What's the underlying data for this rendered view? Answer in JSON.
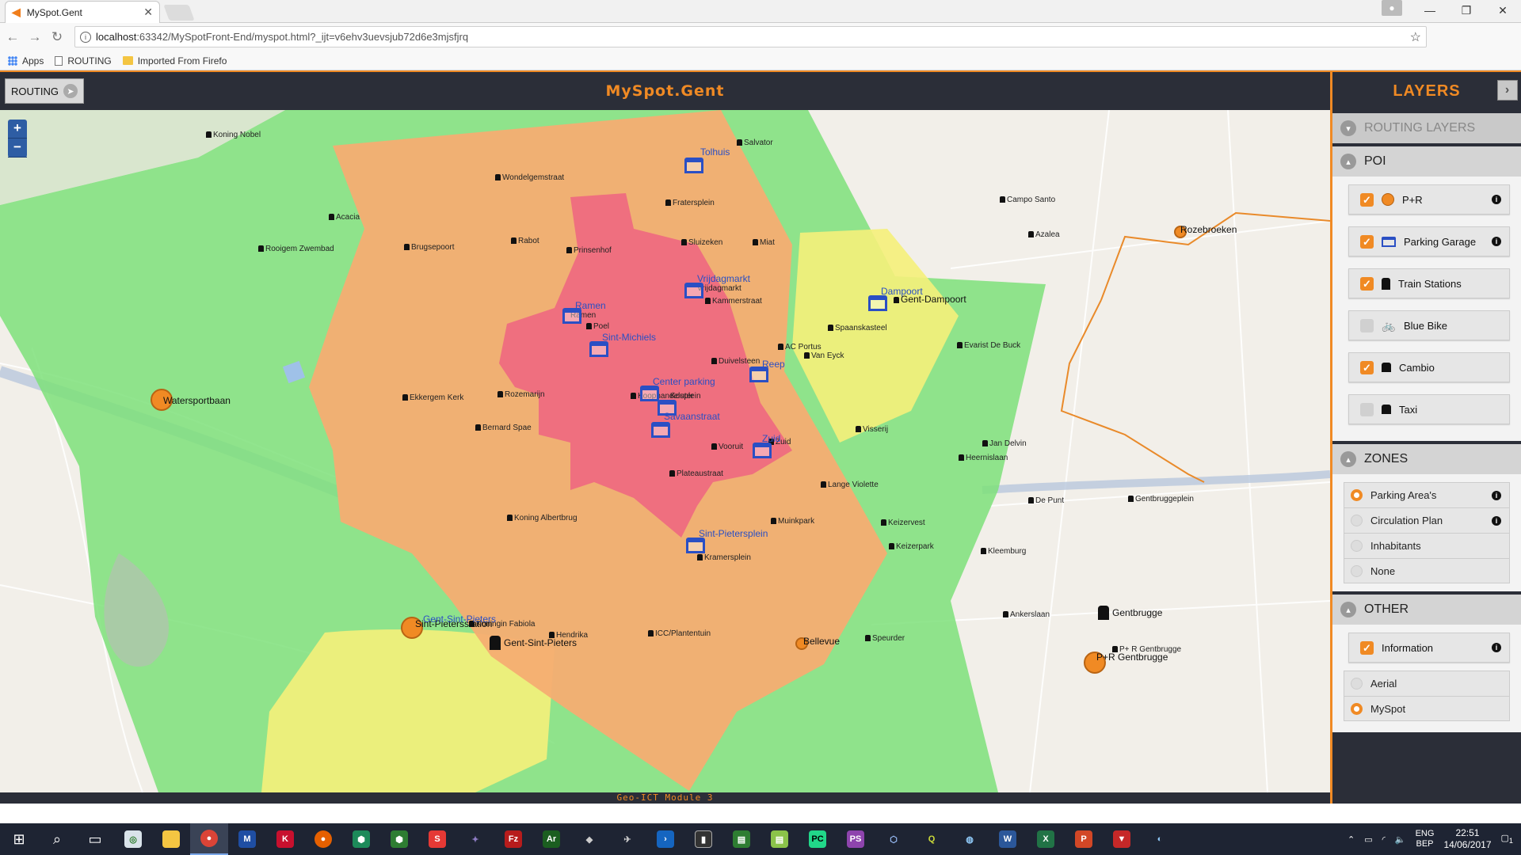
{
  "browser": {
    "tab_title": "MySpot.Gent",
    "url_host": "localhost",
    "url_rest": ":63342/MySpotFront-End/myspot.html?_ijt=v6ehv3uevsjub72d6e3mjsfjrq",
    "bookmarks": [
      "Apps",
      "ROUTING",
      "Imported From Firefo"
    ]
  },
  "app": {
    "routing_button": "ROUTING",
    "title": "MySpot.Gent",
    "footer": "Geo-ICT Module 3"
  },
  "map": {
    "zoom_in": "+",
    "zoom_out": "−",
    "streets": [
      "Koning Nobel",
      "Salvator",
      "Wondelgemstraat",
      "Fratersplein",
      "Acacia",
      "Rabot",
      "Rooigem Zwembad",
      "Brugsepoort",
      "Prinsenhof",
      "Sluizeken",
      "Miat",
      "Vrijdagmarkt",
      "Kammerstraat",
      "Poel",
      "Spaanskasteel",
      "AC Portus",
      "Van Eyck",
      "Duivelsteen",
      "Ekkergem Kerk",
      "Rozemarijn",
      "Koophandelsplein",
      "Bernard Spae",
      "Vooruit",
      "Zuid",
      "Visserij",
      "Plateaustraat",
      "Lange Violette",
      "Koning Albertbrug",
      "Muinkpark",
      "Keizervest",
      "Kramersplein",
      "Keizerpark",
      "Campo Santo",
      "Azalea",
      "Gent-Dampoort",
      "Evarist De Buck",
      "Jan Delvin",
      "Heernislaan",
      "De Punt",
      "Gentbruggeplein",
      "Kleemburg",
      "Ankerslaan",
      "Koningin Fabiola",
      "Hendrika",
      "ICC/Plantentuin",
      "Speurder",
      "P+ R Gentbrugge",
      "Ramen"
    ],
    "garages": [
      "Tolhuis",
      "Vrijdagmarkt",
      "Ramen",
      "Sint-Michiels",
      "Reep",
      "Center parking",
      "Kouter",
      "Savaanstraat",
      "Zuid",
      "Sint-Pietersplein",
      "Dampoort"
    ],
    "park_and_ride": [
      "Watersportbaan",
      "Rozebroeken",
      "Bellevue",
      "Sint-Pietersstation",
      "P+R Gentbrugge"
    ],
    "stations": [
      "Gent-Sint-Pieters",
      "Gentbrugge",
      "Gent-Sint-Pieters"
    ]
  },
  "layers": {
    "title": "LAYERS",
    "routing_section": "ROUTING LAYERS",
    "poi_section": "POI",
    "poi_items": [
      {
        "label": "P+R",
        "checked": true
      },
      {
        "label": "Parking Garage",
        "checked": true
      },
      {
        "label": "Train Stations",
        "checked": true
      },
      {
        "label": "Blue Bike",
        "checked": false
      },
      {
        "label": "Cambio",
        "checked": true
      },
      {
        "label": "Taxi",
        "checked": false
      }
    ],
    "zones_section": "ZONES",
    "zone_items": [
      {
        "label": "Parking Area's",
        "selected": true
      },
      {
        "label": "Circulation Plan",
        "selected": false
      },
      {
        "label": "Inhabitants",
        "selected": false
      },
      {
        "label": "None",
        "selected": false
      }
    ],
    "other_section": "OTHER",
    "other_info": "Information",
    "base_items": [
      {
        "label": "Aerial",
        "selected": false
      },
      {
        "label": "MySpot",
        "selected": true
      }
    ]
  },
  "taskbar": {
    "lang_top": "ENG",
    "lang_bottom": "BEP",
    "time": "22:51",
    "date": "14/06/2017",
    "notif_count": "1"
  },
  "colors": {
    "accent": "#f08a24",
    "header_bg": "#2b2e38",
    "zone_red": "#ee6b80",
    "zone_orange": "#f5ad72",
    "zone_yellow": "#f5f07a",
    "zone_green": "#7ee07a"
  }
}
